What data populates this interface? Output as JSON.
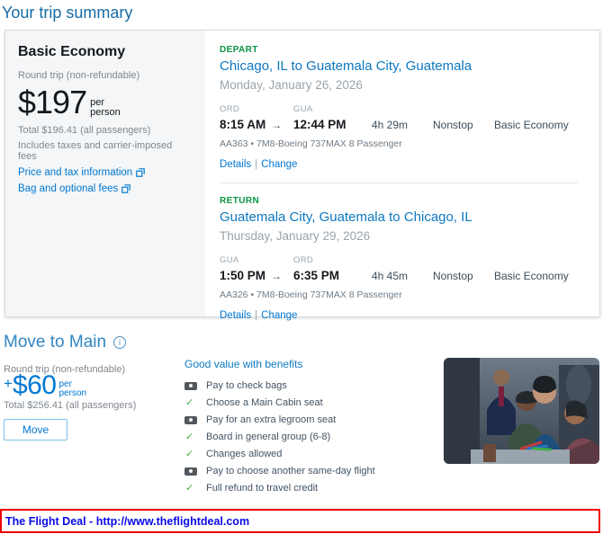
{
  "page": {
    "title": "Your trip summary"
  },
  "summary_card": {
    "fare_name": "Basic Economy",
    "trip_type": "Round trip (non-refundable)",
    "price": "$197",
    "per_line1": "per",
    "per_line2": "person",
    "total": "Total $196.41 (all passengers)",
    "taxes_note": "Includes taxes and carrier-imposed fees",
    "links": [
      {
        "label": "Price and tax information",
        "icon": "external-link-icon"
      },
      {
        "label": "Bag and optional fees",
        "icon": "external-link-icon"
      }
    ]
  },
  "segments": [
    {
      "direction": "DEPART",
      "route": "Chicago, IL to Guatemala City, Guatemala",
      "date": "Monday, January 26, 2026",
      "origin_code": "ORD",
      "dest_code": "GUA",
      "depart_time": "8:15 AM",
      "arrive_time": "12:44 PM",
      "duration": "4h 29m",
      "stops": "Nonstop",
      "fare": "Basic Economy",
      "flight_info": "AA363 • 7M8-Boeing 737MAX 8 Passenger",
      "details_label": "Details",
      "change_label": "Change"
    },
    {
      "direction": "RETURN",
      "route": "Guatemala City, Guatemala to Chicago, IL",
      "date": "Thursday, January 29, 2026",
      "origin_code": "GUA",
      "dest_code": "ORD",
      "depart_time": "1:50 PM",
      "arrive_time": "6:35 PM",
      "duration": "4h 45m",
      "stops": "Nonstop",
      "fare": "Basic Economy",
      "flight_info": "AA326 • 7M8-Boeing 737MAX 8 Passenger",
      "details_label": "Details",
      "change_label": "Change"
    }
  ],
  "upsell": {
    "title": "Move to Main",
    "info_icon_glyph": "i",
    "trip_type": "Round trip (non-refundable)",
    "plus": "+",
    "price": "$60",
    "per_line1": "per",
    "per_line2": "person",
    "total": "Total $256.41 (all passengers)",
    "move_button": "Move",
    "benefits_title": "Good value with benefits",
    "benefits": [
      {
        "icon": "pay",
        "label": "Pay to check bags"
      },
      {
        "icon": "check",
        "label": "Choose a Main Cabin seat"
      },
      {
        "icon": "pay",
        "label": "Pay for an extra legroom seat"
      },
      {
        "icon": "check",
        "label": "Board in general group (6-8)"
      },
      {
        "icon": "check",
        "label": "Changes allowed"
      },
      {
        "icon": "pay",
        "label": "Pay to choose another same-day flight"
      },
      {
        "icon": "check",
        "label": "Full refund to travel credit"
      }
    ]
  },
  "footer_banner": {
    "text": "The Flight Deal - http://www.theflightdeal.com"
  },
  "glyphs": {
    "arrow_right": "→",
    "pipe": "|"
  },
  "colors": {
    "aa_link_blue": "#0078d2",
    "heading_blue": "#176ca6",
    "depart_green": "#0b9444",
    "check_green": "#3fae49",
    "banner_red": "#ef0000",
    "banner_link_blue": "#0a0ae8",
    "fare_panel_bg": "#f4f6f7"
  }
}
